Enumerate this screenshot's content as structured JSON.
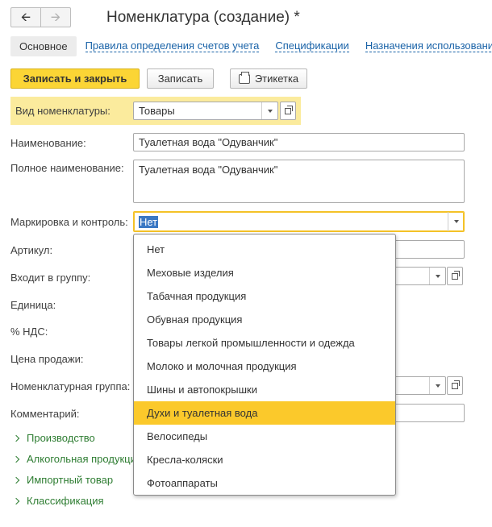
{
  "nav": {
    "back_icon": "arrow-left-icon",
    "forward_icon": "arrow-right-icon"
  },
  "window_title": "Номенклатура (создание) *",
  "tabs": [
    {
      "label": "Основное"
    },
    {
      "label": "Правила определения счетов учета"
    },
    {
      "label": "Спецификации"
    },
    {
      "label": "Назначения использования"
    }
  ],
  "toolbar": {
    "save_close_label": "Записать и закрыть",
    "save_label": "Записать",
    "label_print": "Этикетка"
  },
  "form": {
    "kind_label": "Вид номенклатуры:",
    "kind_value": "Товары",
    "name_label": "Наименование:",
    "name_value": "Туалетная вода \"Одуванчик\"",
    "full_name_label": "Полное наименование:",
    "full_name_value": "Туалетная вода \"Одуванчик\"",
    "marking_label": "Маркировка и контроль:",
    "marking_value": "Нет",
    "article_label": "Артикул:",
    "group_label": "Входит в группу:",
    "unit_label": "Единица:",
    "vat_label": "% НДС:",
    "price_label": "Цена продажи:",
    "nom_group_label": "Номенклатурная группа:",
    "comment_label": "Комментарий:"
  },
  "sections": [
    {
      "label": "Производство"
    },
    {
      "label": "Алкогольная продукция"
    },
    {
      "label": "Импортный товар"
    },
    {
      "label": "Классификация"
    }
  ],
  "dropdown": {
    "highlighted_index": 7,
    "highlight_color": "#fbc92b",
    "items": [
      "Нет",
      "Меховые изделия",
      "Табачная продукция",
      "Обувная продукция",
      "Товары легкой промышленности и одежда",
      "Молоко и молочная продукция",
      "Шины и автопокрышки",
      "Духи и туалетная вода",
      "Велосипеды",
      "Кресла-коляски",
      "Фотоаппараты"
    ]
  },
  "colors": {
    "accent": "#fbd535",
    "link": "#1a63a8",
    "section": "#2e7d32",
    "selection": "#3b78c4"
  }
}
